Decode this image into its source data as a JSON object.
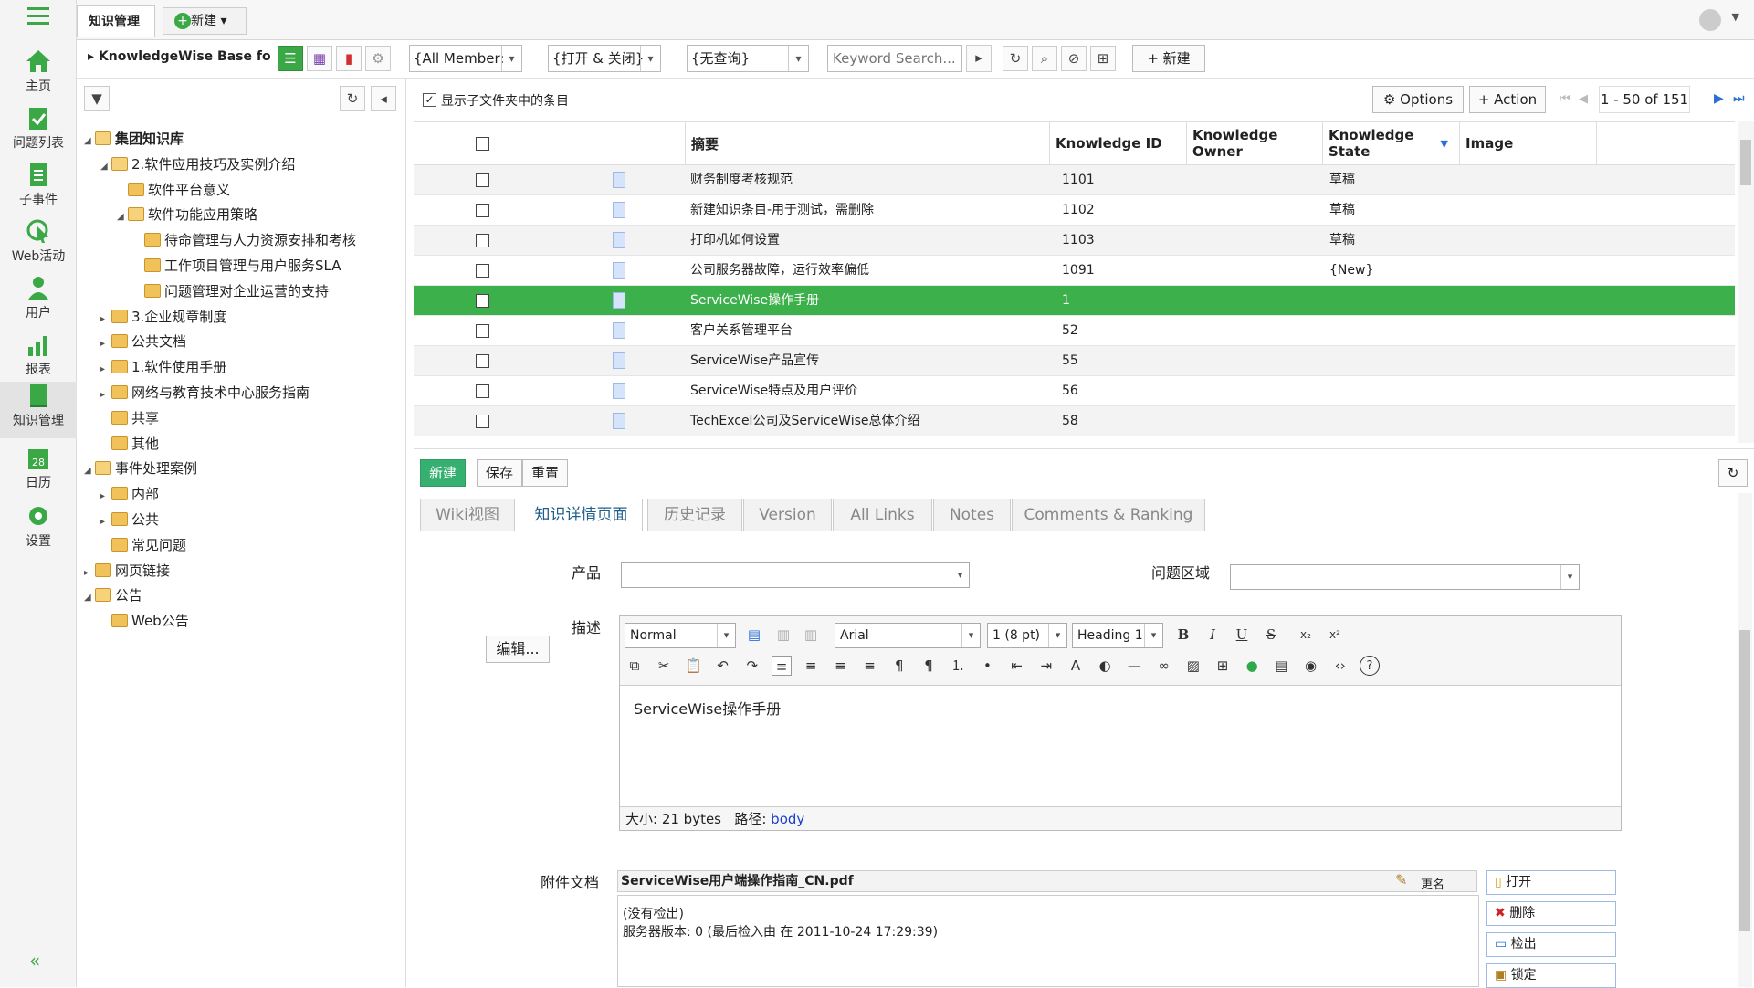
{
  "nav": {
    "items": [
      {
        "label": "主页"
      },
      {
        "label": "问题列表"
      },
      {
        "label": "子事件"
      },
      {
        "label": "Web活动"
      },
      {
        "label": "用户"
      },
      {
        "label": "报表"
      },
      {
        "label": "知识管理"
      },
      {
        "label": "日历"
      },
      {
        "label": "设置"
      }
    ],
    "collapse": "«"
  },
  "topbar": {
    "tab_active": "知识管理",
    "new_tab": "新建"
  },
  "toolbar": {
    "project": "KnowledgeWise Base for",
    "member_filter": "{All Member:",
    "state_filter": "{打开 & 关闭}",
    "query_filter": "{无查询}",
    "search_placeholder": "Keyword Search...",
    "new_label": "新建"
  },
  "tree": {
    "nodes": [
      {
        "label": "集团知识库",
        "level": 0,
        "expanded": true,
        "bold": true
      },
      {
        "label": "2.软件应用技巧及实例介绍",
        "level": 1,
        "expanded": true
      },
      {
        "label": "软件平台意义",
        "level": 2,
        "leaf": true
      },
      {
        "label": "软件功能应用策略",
        "level": 2,
        "expanded": true
      },
      {
        "label": "待命管理与人力资源安排和考核",
        "level": 3,
        "leaf": true
      },
      {
        "label": "工作项目管理与用户服务SLA",
        "level": 3,
        "leaf": true
      },
      {
        "label": "问题管理对企业运营的支持",
        "level": 3,
        "leaf": true
      },
      {
        "label": "3.企业规章制度",
        "level": 1
      },
      {
        "label": "公共文档",
        "level": 1
      },
      {
        "label": "1.软件使用手册",
        "level": 1
      },
      {
        "label": "网络与教育技术中心服务指南",
        "level": 1
      },
      {
        "label": "共享",
        "level": 1,
        "leaf": true
      },
      {
        "label": "其他",
        "level": 1,
        "leaf": true
      },
      {
        "label": "事件处理案例",
        "level": 0,
        "expanded": true
      },
      {
        "label": "内部",
        "level": 1
      },
      {
        "label": "公共",
        "level": 1
      },
      {
        "label": "常见问题",
        "level": 1,
        "leaf": true
      },
      {
        "label": "网页链接",
        "level": 0
      },
      {
        "label": "公告",
        "level": 0,
        "expanded": true
      },
      {
        "label": "Web公告",
        "level": 1,
        "leaf": true
      }
    ]
  },
  "grid": {
    "show_sub": "显示子文件夹中的条目",
    "options": "Options",
    "action": "Action",
    "paging": "1 - 50 of 151",
    "columns": [
      "摘要",
      "Knowledge ID",
      "Knowledge Owner",
      "Knowledge State",
      "Image"
    ],
    "rows": [
      {
        "summary": "财务制度考核规范",
        "id": "1101",
        "owner": "",
        "state": "草稿"
      },
      {
        "summary": "新建知识条目-用于测试，需删除",
        "id": "1102",
        "owner": "",
        "state": "草稿"
      },
      {
        "summary": "打印机如何设置",
        "id": "1103",
        "owner": "",
        "state": "草稿"
      },
      {
        "summary": "公司服务器故障，运行效率偏低",
        "id": "1091",
        "owner": "",
        "state": "{New}"
      },
      {
        "summary": "ServiceWise操作手册",
        "id": "1",
        "owner": "",
        "state": ""
      },
      {
        "summary": "客户关系管理平台",
        "id": "52",
        "owner": "",
        "state": ""
      },
      {
        "summary": "ServiceWise产品宣传",
        "id": "55",
        "owner": "",
        "state": ""
      },
      {
        "summary": "ServiceWise特点及用户评价",
        "id": "56",
        "owner": "",
        "state": ""
      },
      {
        "summary": "TechExcel公司及ServiceWise总体介绍",
        "id": "58",
        "owner": "",
        "state": ""
      }
    ]
  },
  "detail": {
    "new": "新建",
    "save": "保存",
    "reset": "重置",
    "tabs": [
      "Wiki视图",
      "知识详情页面",
      "历史记录",
      "Version",
      "All Links",
      "Notes",
      "Comments & Ranking"
    ],
    "product_label": "产品",
    "area_label": "问题区域",
    "desc_label": "描述",
    "edit_button": "编辑...",
    "editor": {
      "style": "Normal",
      "font": "Arial",
      "size": "1 (8 pt)",
      "heading": "Heading 1",
      "content": "ServiceWise操作手册",
      "size_info": "大小: 21 bytes",
      "path_label": "路径:",
      "path_value": "body"
    },
    "attach_label": "附件文档",
    "attach_file": "ServiceWise用户端操作指南_CN.pdf",
    "rename": "更名",
    "attach_status1": "(没有检出)",
    "attach_status2": "服务器版本: 0 (最后检入由 在 2011-10-24 17:29:39)",
    "attach_buttons": [
      "打开",
      "删除",
      "检出",
      "锁定"
    ]
  }
}
